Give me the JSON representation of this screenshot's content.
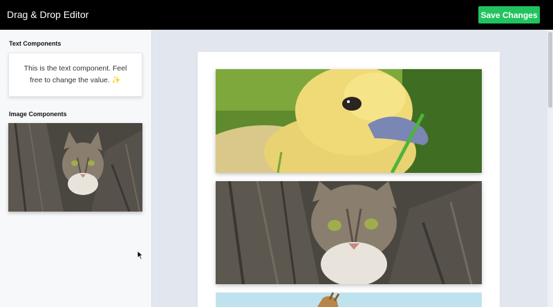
{
  "header": {
    "title": "Drag & Drop Editor",
    "save_label": "Save Changes"
  },
  "sidebar": {
    "text_section_title": "Text Components",
    "text_component": "This is the text component. Feel free to change the value. ✨",
    "image_section_title": "Image Components"
  },
  "canvas": {
    "images": [
      "duckling",
      "kitten",
      "giraffe"
    ]
  },
  "colors": {
    "accent": "#22c35e",
    "topbar": "#000000",
    "canvas_bg": "#e2e6ee"
  }
}
